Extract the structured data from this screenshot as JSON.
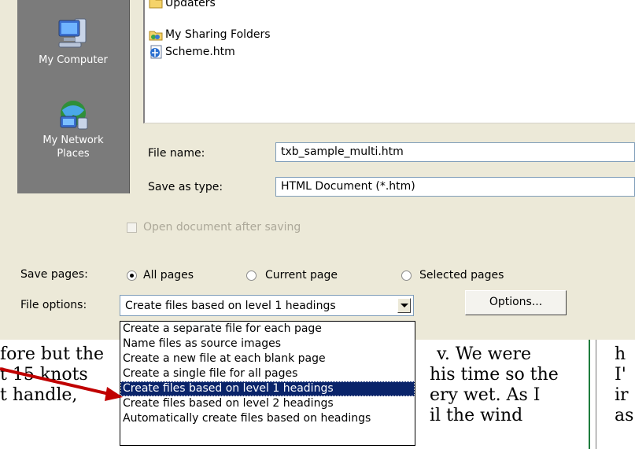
{
  "places": [
    {
      "label_lines": [
        "My Computer"
      ],
      "icon": "my-computer-icon"
    },
    {
      "label_lines": [
        "My Network",
        "Places"
      ],
      "icon": "network-places-icon"
    }
  ],
  "files": [
    {
      "name": "Updaters",
      "icon": "folder-icon"
    },
    {
      "name": "My Sharing Folders",
      "icon": "shared-folder-icon"
    },
    {
      "name": "Scheme.htm",
      "icon": "html-file-icon"
    }
  ],
  "form": {
    "file_name_label": "File name:",
    "file_name_value": "txb_sample_multi.htm",
    "save_type_label": "Save as type:",
    "save_type_value": "HTML Document (*.htm)",
    "open_after_label": "Open document after saving",
    "save_pages_label": "Save pages:",
    "radio_all": "All pages",
    "radio_current": "Current page",
    "radio_selected": "Selected pages",
    "file_options_label": "File options:",
    "file_options_value": "Create files based on level 1 headings",
    "options_button": "Options..."
  },
  "dropdown": {
    "items": [
      "Create a separate file for each page",
      "Name files as source images",
      "Create a new file at each blank page",
      "Create a single file for all pages",
      "Create files based on level 1 headings",
      "Create files based on level 2 headings",
      "Automatically create files based on headings"
    ],
    "selected_index": 4
  },
  "document": {
    "left_lines": [
      "fore but the",
      "t 15 knots",
      "t handle,"
    ],
    "mid_lines": [
      "v. We were",
      "his time so the",
      "ery wet. As I",
      "il  the wind"
    ],
    "right_lines": [
      "h",
      "I'",
      "ir",
      "as"
    ]
  },
  "colors": {
    "selection": "#0a246a",
    "arrow": "#c00000",
    "places_bg": "#7b7b7b",
    "dialog_bg": "#ece9d8"
  }
}
